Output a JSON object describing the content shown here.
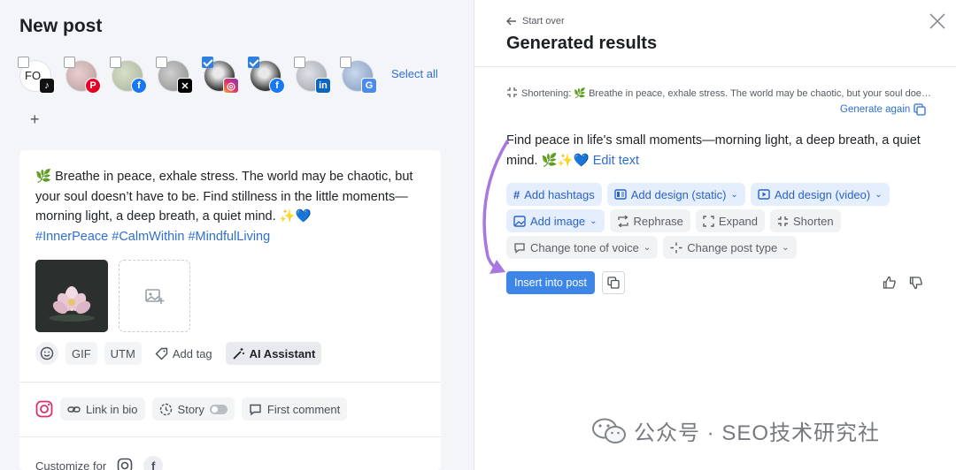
{
  "left": {
    "title": "New post",
    "accounts": [
      {
        "initials": "FO",
        "network": "tiktok",
        "checked": false
      },
      {
        "network": "pinterest",
        "checked": false
      },
      {
        "network": "facebook",
        "checked": false
      },
      {
        "network": "x",
        "checked": false
      },
      {
        "network": "instagram",
        "checked": true
      },
      {
        "network": "facebook",
        "checked": true
      },
      {
        "network": "linkedin",
        "checked": false
      },
      {
        "network": "google-business",
        "checked": false
      }
    ],
    "select_all": "Select all",
    "add": "+",
    "post": {
      "text": "🌿 Breathe in peace, exhale stress. The world may be chaotic, but your soul doesn’t have to be. Find stillness in the little moments—morning light, a deep breath, a quiet mind. ✨💙",
      "hashtags": "#InnerPeace #CalmWithin #MindfulLiving"
    },
    "toolbar": {
      "gif": "GIF",
      "utm": "UTM",
      "add_tag": "Add tag",
      "ai_assistant": "AI Assistant"
    },
    "options": {
      "link_in_bio": "Link in bio",
      "story": "Story",
      "first_comment": "First comment"
    },
    "customize_for": "Customize for"
  },
  "right": {
    "start_over": "Start over",
    "title": "Generated results",
    "shortening_label": "Shortening:",
    "shortening_text": "🌿 Breathe in peace, exhale stress. The world may be chaotic, but your soul doesn’t have to be.",
    "generate_again": "Generate again",
    "result_text": "Find peace in life's small moments—morning light, a deep breath, a quiet mind. 🌿✨💙",
    "edit_text": "Edit text",
    "actions_row1": [
      "Add hashtags",
      "Add design (static)",
      "Add design (video)"
    ],
    "actions_row2": [
      "Add image",
      "Rephrase",
      "Expand",
      "Shorten"
    ],
    "actions_row3": [
      "Change tone of voice",
      "Change post type"
    ],
    "insert": "Insert into post"
  },
  "watermark": "公众号 · SEO技术研究社",
  "colors": {
    "accent": "#3d86e8",
    "link": "#2f6fd1",
    "arrow": "#a678e0"
  }
}
